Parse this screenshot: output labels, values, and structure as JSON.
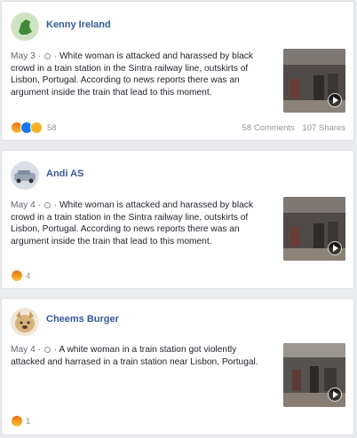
{
  "posts": [
    {
      "author": "Kenny Ireland",
      "date": "May 3",
      "separator": "·",
      "text": "White woman is attacked and harassed by black crowd in a train station in the Sintra railway line, outskirts of Lisbon, Portugal. According to news reports there was an argument inside the train that lead to this moment.",
      "reactions_count": "58",
      "comments": "58 Comments",
      "shares": "107 Shares",
      "reaction_icons": [
        "angry-react-icon",
        "like-react-icon",
        "wow-react-icon"
      ]
    },
    {
      "author": "Andi AS",
      "date": "May 4",
      "separator": "·",
      "text": "White woman is attacked and harassed by black crowd in a train station in the Sintra railway line, outskirts of Lisbon, Portugal. According to news reports there was an argument inside the train that lead to this moment.",
      "reactions_count": "4",
      "reaction_icons": [
        "angry-react-icon"
      ]
    },
    {
      "author": "Cheems Burger",
      "date": "May 4",
      "separator": "·",
      "text": "A white woman in a train station got violently attacked and harrased in a train station near Lisbon, Portugal.",
      "reactions_count": "1",
      "reaction_icons": [
        "angry-react-icon"
      ]
    }
  ],
  "colors": {
    "author_link": "#365899",
    "background": "#e9ebee",
    "muted": "#90949c"
  }
}
